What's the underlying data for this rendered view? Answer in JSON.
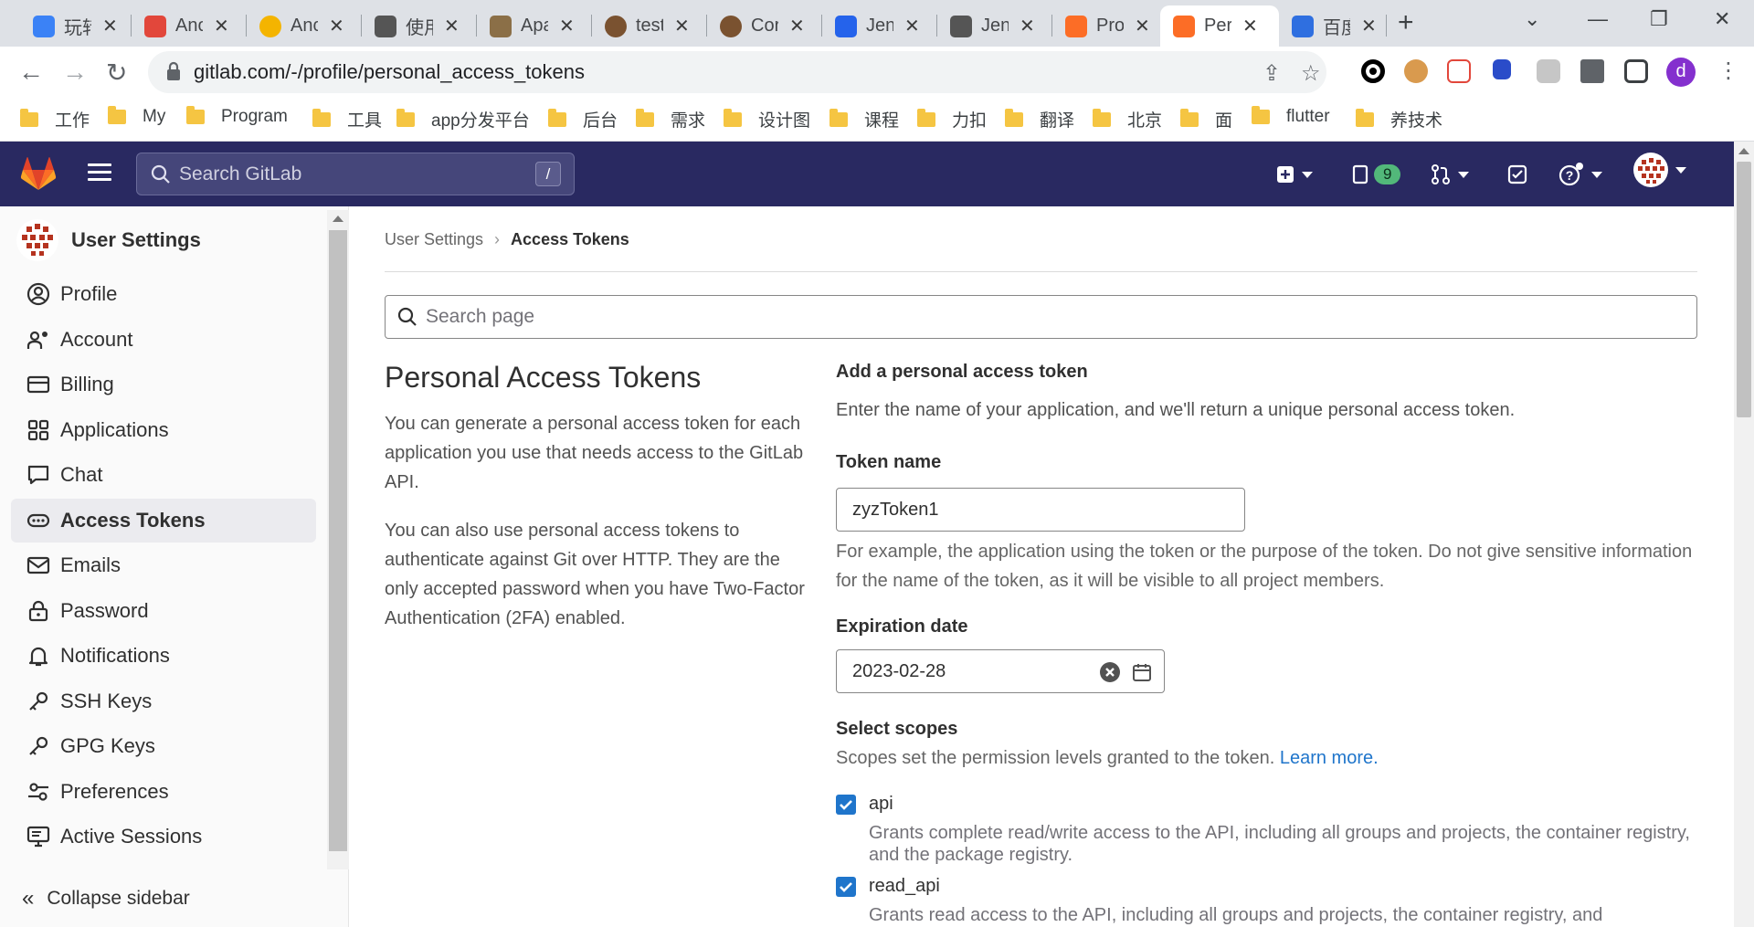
{
  "browser": {
    "tabs": [
      {
        "label": "玩转",
        "color": "#3b82f6"
      },
      {
        "label": "Ano",
        "color": "#e2473b"
      },
      {
        "label": "Anc",
        "color": "#f4b400"
      },
      {
        "label": "使用",
        "color": "#555555"
      },
      {
        "label": "Apa",
        "color": "#8b6f47"
      },
      {
        "label": "test",
        "color": "#7a5230"
      },
      {
        "label": "Cor",
        "color": "#7a5230"
      },
      {
        "label": "Jen",
        "color": "#2563eb"
      },
      {
        "label": "Jen",
        "color": "#555555"
      },
      {
        "label": "Pro",
        "color": "#fc6d26"
      },
      {
        "label": "Per",
        "color": "#fc6d26"
      },
      {
        "label": "百度",
        "color": "#2f6fe0"
      }
    ],
    "new_tab": "+",
    "url": "gitlab.com/-/profile/personal_access_tokens",
    "profile_initial": "d",
    "bookmarks": [
      "工作",
      "My",
      "Program",
      "工具",
      "app分发平台",
      "后台",
      "需求",
      "设计图",
      "课程",
      "力扣",
      "翻译",
      "北京",
      "面",
      "flutter",
      "养技术"
    ]
  },
  "header": {
    "search_placeholder": "Search GitLab",
    "search_shortcut": "/",
    "issues_count": "9"
  },
  "sidebar": {
    "title": "User Settings",
    "items": [
      {
        "label": "Profile"
      },
      {
        "label": "Account"
      },
      {
        "label": "Billing"
      },
      {
        "label": "Applications"
      },
      {
        "label": "Chat"
      },
      {
        "label": "Access Tokens"
      },
      {
        "label": "Emails"
      },
      {
        "label": "Password"
      },
      {
        "label": "Notifications"
      },
      {
        "label": "SSH Keys"
      },
      {
        "label": "GPG Keys"
      },
      {
        "label": "Preferences"
      },
      {
        "label": "Active Sessions"
      }
    ],
    "collapse_label": "Collapse sidebar"
  },
  "breadcrumb": {
    "parent": "User Settings",
    "current": "Access Tokens"
  },
  "page_search_placeholder": "Search page",
  "intro": {
    "title": "Personal Access Tokens",
    "p1": "You can generate a personal access token for each application you use that needs access to the GitLab API.",
    "p2": "You can also use personal access tokens to authenticate against Git over HTTP. They are the only accepted password when you have Two-Factor Authentication (2FA) enabled."
  },
  "form": {
    "heading": "Add a personal access token",
    "description": "Enter the name of your application, and we'll return a unique personal access token.",
    "token_name_label": "Token name",
    "token_name_value": "zyzToken1",
    "token_name_help": "For example, the application using the token or the purpose of the token. Do not give sensitive information for the name of the token, as it will be visible to all project members.",
    "expiration_label": "Expiration date",
    "expiration_value": "2023-02-28",
    "scopes_label": "Select scopes",
    "scopes_help": "Scopes set the permission levels granted to the token.",
    "learn_more": "Learn more.",
    "scopes": [
      {
        "name": "api",
        "checked": true,
        "help": "Grants complete read/write access to the API, including all groups and projects, the container registry, and the package registry."
      },
      {
        "name": "read_api",
        "checked": true,
        "help": "Grants read access to the API, including all groups and projects, the container registry, and"
      }
    ]
  },
  "colors": {
    "header_bg": "#292961",
    "link": "#1f75cb",
    "checkbox": "#1f75cb",
    "badge": "#52b87a"
  }
}
